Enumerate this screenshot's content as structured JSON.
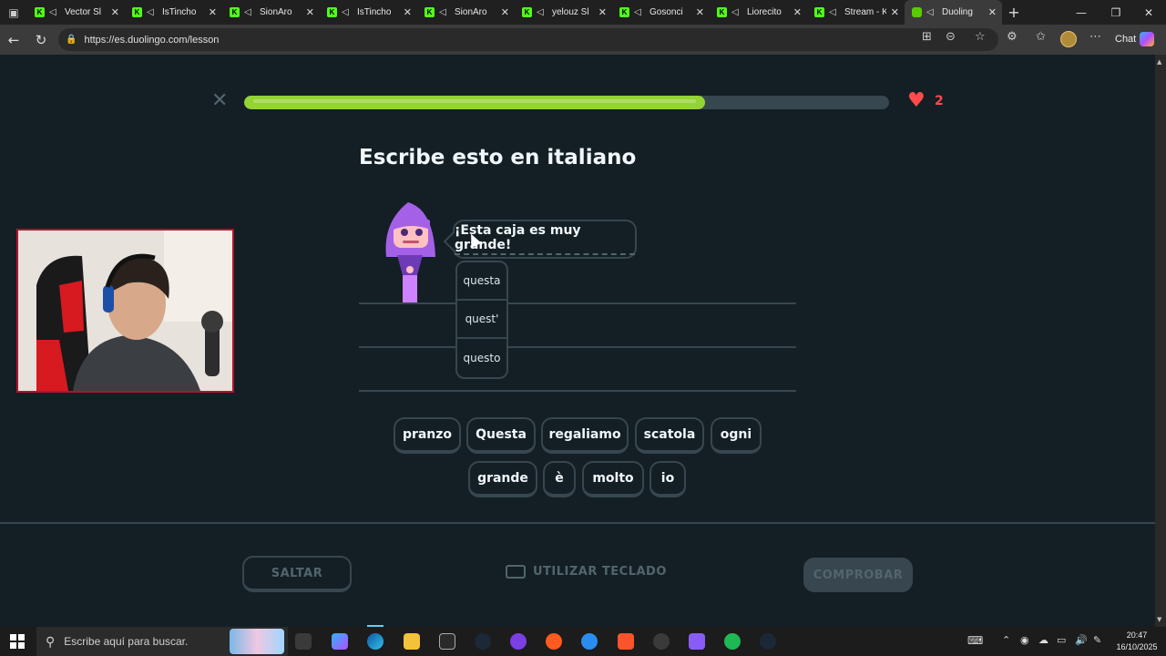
{
  "browser": {
    "tabs": [
      {
        "title": "Vector Sl",
        "kind": "kick"
      },
      {
        "title": "IsTincho",
        "kind": "kick"
      },
      {
        "title": "SionAro",
        "kind": "kick"
      },
      {
        "title": "IsTincho",
        "kind": "kick"
      },
      {
        "title": "SionAro",
        "kind": "kick"
      },
      {
        "title": "yelouz Sl",
        "kind": "kick"
      },
      {
        "title": "Gosonci",
        "kind": "kick"
      },
      {
        "title": "Liorecito",
        "kind": "kick"
      },
      {
        "title": "Stream - Kick",
        "kind": "kick"
      },
      {
        "title": "Duoling",
        "kind": "duolingo",
        "active": true
      }
    ],
    "url": "https://es.duolingo.com/lesson",
    "chat_label": "Chat"
  },
  "lesson": {
    "progress": 0.715,
    "hearts": "2",
    "instruction": "Escribe esto en italiano",
    "prompt_sentence": "¡Esta caja es muy grande!",
    "hints": [
      "questa",
      "quest'",
      "questo"
    ],
    "word_bank_row1": [
      "pranzo",
      "Questa",
      "regaliamo",
      "scatola",
      "ogni"
    ],
    "word_bank_row2": [
      "grande",
      "è",
      "molto",
      "io"
    ],
    "skip_label": "SALTAR",
    "keyboard_label": "UTILIZAR TECLADO",
    "check_label": "COMPROBAR"
  },
  "colors": {
    "background": "#131f24",
    "progress_fill": "#93d333",
    "heart": "#ff4b4b",
    "border": "#37464f",
    "muted": "#52656d",
    "webcam_border": "#b3132b"
  },
  "taskbar": {
    "search_placeholder": "Escribe aquí para buscar.",
    "time": "20:47",
    "date": "16/10/2025"
  }
}
